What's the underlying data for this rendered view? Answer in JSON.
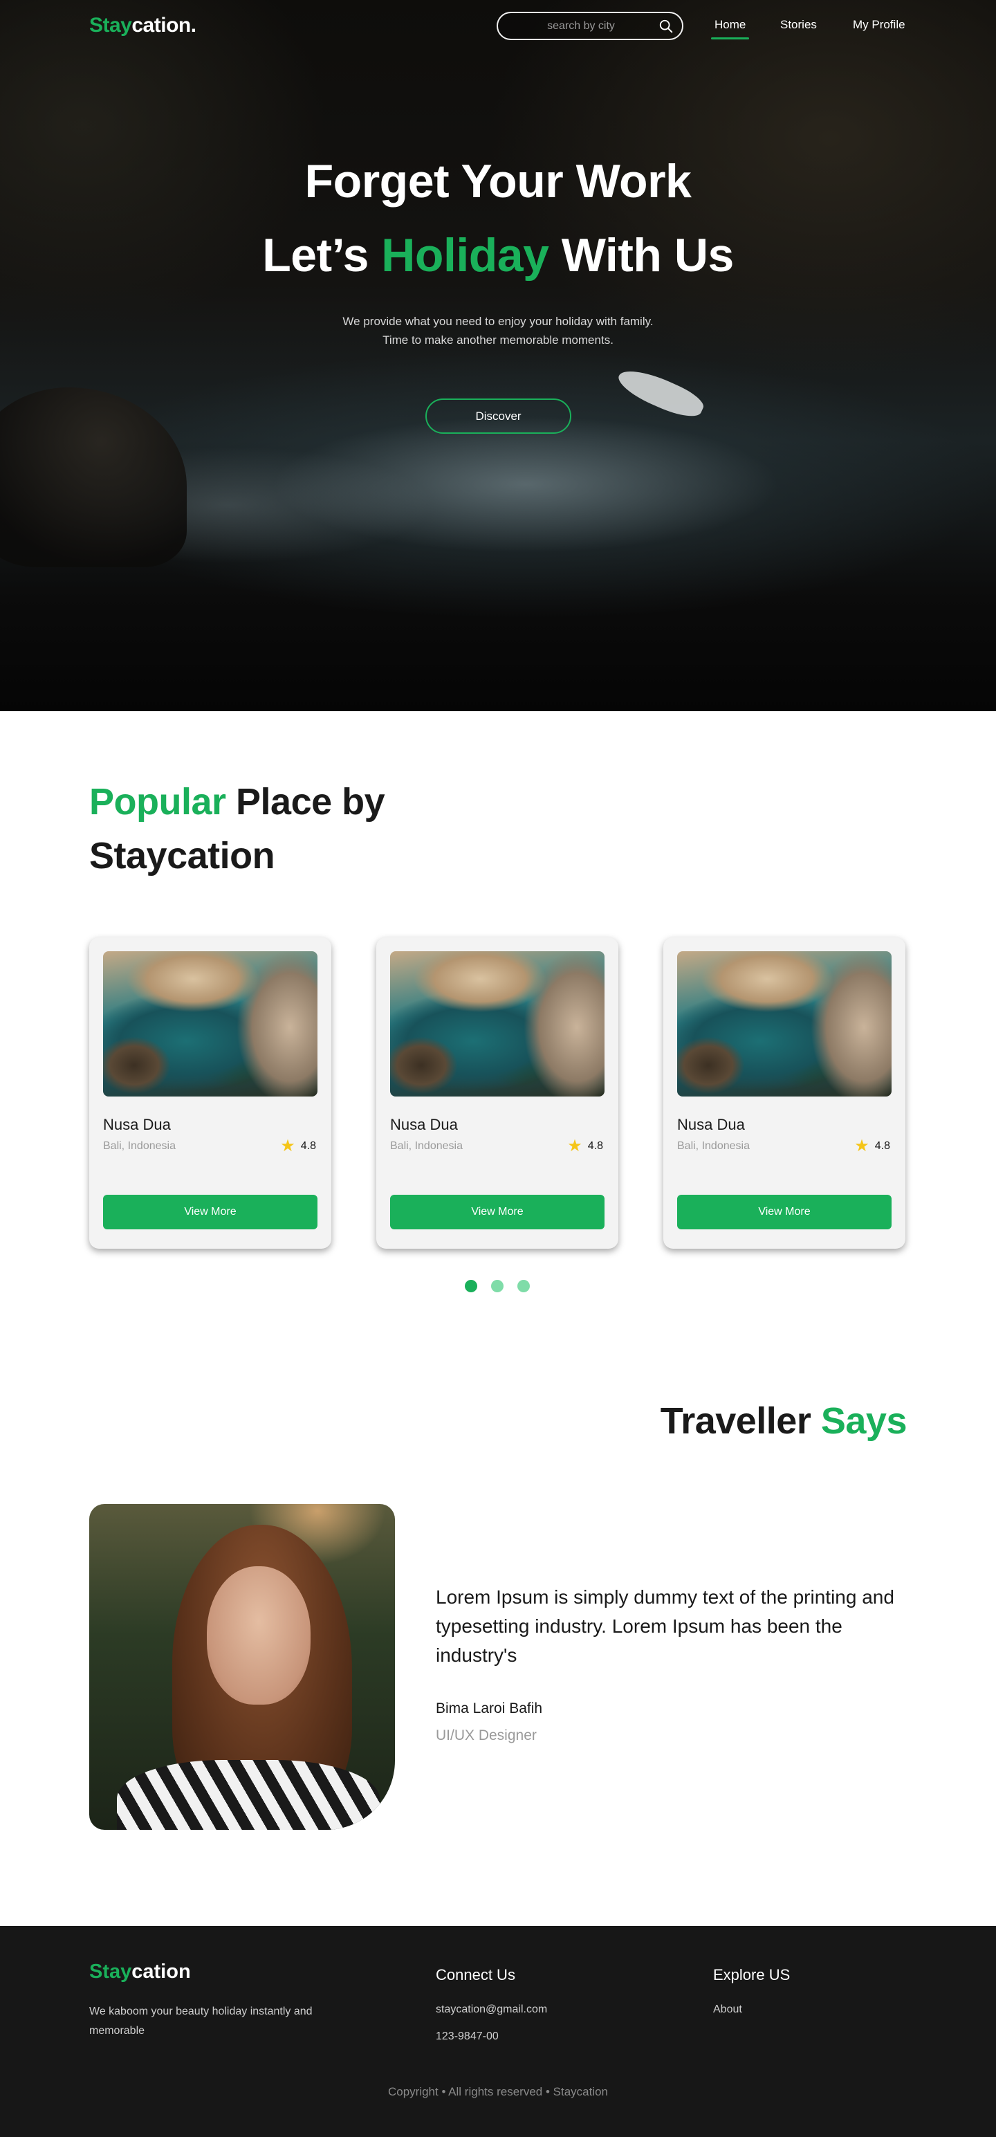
{
  "brand": {
    "logo_highlight": "Stay",
    "logo_rest": "cation."
  },
  "nav": {
    "search_placeholder": "search by city",
    "links": [
      {
        "label": "Home",
        "active": true
      },
      {
        "label": "Stories"
      },
      {
        "label": "My Profile"
      }
    ]
  },
  "hero": {
    "line1": "Forget Your Work",
    "line2_before": "Let’s ",
    "line2_highlight": "Holiday",
    "line2_after": " With Us",
    "desc_line1": "We provide what you need to enjoy your holiday with family.",
    "desc_line2": "Time to make another memorable moments.",
    "cta_label": "Discover"
  },
  "popular": {
    "title_highlight": "Popular",
    "title_rest": " Place by Staycation",
    "cards": [
      {
        "name": "Nusa Dua",
        "location": "Bali, Indonesia",
        "rating": "4.8",
        "button_label": "View More"
      },
      {
        "name": "Nusa Dua",
        "location": "Bali, Indonesia",
        "rating": "4.8",
        "button_label": "View More"
      },
      {
        "name": "Nusa Dua",
        "location": "Bali, Indonesia",
        "rating": "4.8",
        "button_label": "View More"
      }
    ],
    "carousel_active_index": 0
  },
  "testimonial": {
    "title_rest": "Traveller ",
    "title_highlight": "Says",
    "quote": "Lorem Ipsum is simply dummy text of the printing and typesetting industry. Lorem Ipsum has been the industry's",
    "author_name": "Bima Laroi Bafih",
    "author_role": "UI/UX Designer"
  },
  "footer": {
    "logo_highlight": "Stay",
    "logo_rest": "cation",
    "tagline": "We kaboom your beauty holiday instantly and memorable",
    "connect_heading": "Connect Us",
    "email": "staycation@gmail.com",
    "phone": "123-9847-00",
    "explore_heading": "Explore  US",
    "explore_links": [
      "About"
    ],
    "copyright": "Copyright • All rights reserved • Staycation"
  },
  "colors": {
    "accent": "#1ab05a",
    "accent_light": "#7fdca8",
    "footer_bg": "#171717",
    "star": "#f5c518"
  },
  "icons": [
    "search-icon",
    "star-icon"
  ]
}
